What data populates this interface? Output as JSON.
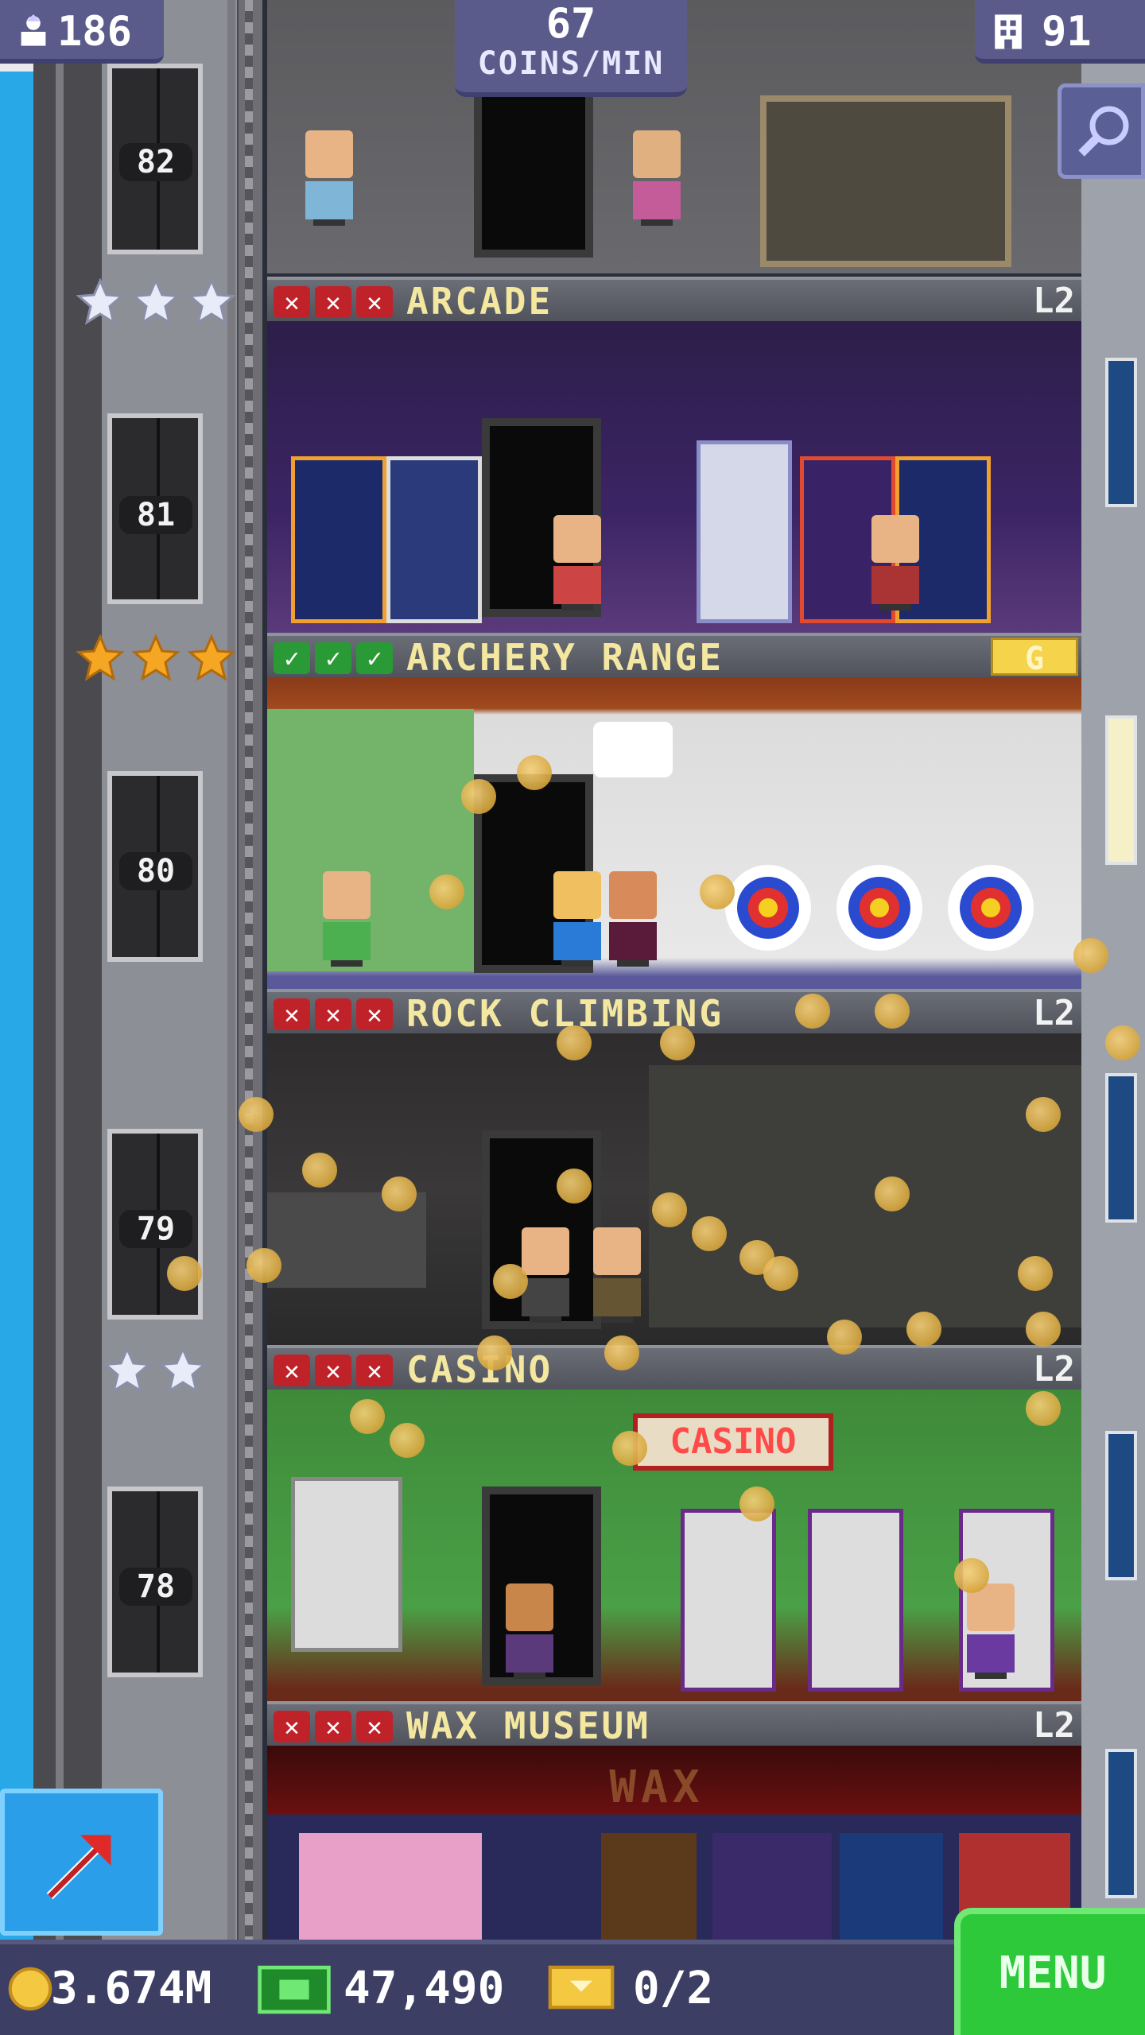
{
  "hud": {
    "population": "186",
    "coins_per_min_value": "67",
    "coins_per_min_label": "COINS/MIN",
    "floors_count": "91"
  },
  "elevator": {
    "floor_numbers": [
      "82",
      "81",
      "80",
      "79",
      "78"
    ]
  },
  "floors": [
    {
      "name": "ARCADE",
      "level": "L2",
      "status": "x x x"
    },
    {
      "name": "ARCHERY RANGE",
      "badge": "G",
      "status": "ok ok ok"
    },
    {
      "name": "ROCK CLIMBING",
      "level": "L2",
      "status": "x x x"
    },
    {
      "name": "CASINO",
      "level": "L2",
      "status": "x x x"
    },
    {
      "name": "WAX MUSEUM",
      "level": "L2",
      "status": "x x x"
    }
  ],
  "signs": {
    "casino_sign": "CASINO",
    "wax_sign": "WAX"
  },
  "footer": {
    "coins": "3.674M",
    "bux": "47,490",
    "tickets": "0/2",
    "menu_label": "MENU"
  },
  "colors": {
    "sky": "#28a8e6",
    "menu_green": "#2ec93a",
    "header_text": "#f4e8a0",
    "fail_red": "#c0222a",
    "ok_green": "#2a9a36",
    "coin_gold": "#f5d07a"
  },
  "icons": {
    "population": "person-up-icon",
    "floors": "building-icon",
    "zoom": "magnifier-icon",
    "action": "arrow-up-right-icon",
    "coin": "coin-icon",
    "bux": "bux-bill-icon",
    "ticket": "vip-ticket-icon",
    "star_silver": "silver-star-icon",
    "star_gold": "gold-star-icon"
  }
}
